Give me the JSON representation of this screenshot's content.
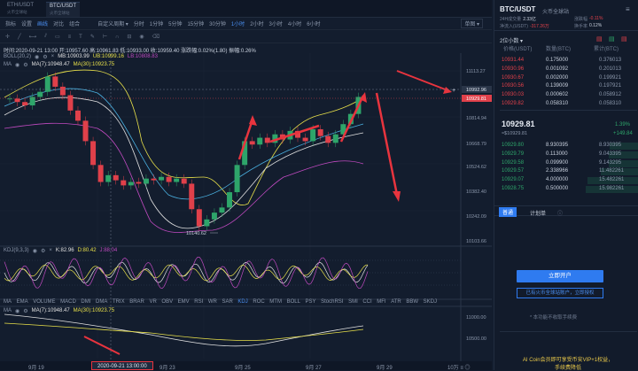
{
  "tabs": [
    {
      "label": "ETH/USDT",
      "sub": "火币全球站"
    },
    {
      "label": "BTC/USDT",
      "sub": "火币全球站"
    }
  ],
  "toolbar": {
    "items": [
      "指标",
      "设置",
      "画线",
      "对比",
      "组合",
      "自定义周期 ▾",
      "分时",
      "1分钟",
      "5分钟",
      "15分钟",
      "30分钟",
      "1小时",
      "2小时",
      "3小时",
      "4小时",
      "6小时"
    ],
    "active": [
      "画线",
      "1小时"
    ],
    "select": "单图 ▾"
  },
  "ohlc": "时间:2020-09-21 13:00 开:10957.60 高:10961.83 低:10933.00 收:10959.40 涨跌幅:0.02%(1.80) 振幅:0.26%",
  "boll": {
    "name": "BOLL(20,2)",
    "mb": "MB:10903.99",
    "ub": "UB:10999.16",
    "lb": "LB:10808.83"
  },
  "ma": {
    "name": "MA",
    "ma7": "MA(7):10948.47",
    "ma30": "MA(30):10923.75"
  },
  "kdj": {
    "name": "KDJ(9,3,3)",
    "k": "K:82.96",
    "d": "D:80.42",
    "j": "J:88.04"
  },
  "ma2": {
    "name": "MA",
    "ma7": "MA(7):10948.47",
    "ma30": "MA(30):10923.75"
  },
  "indicators": [
    "MA",
    "EMA",
    "VOLUME",
    "MACD",
    "DMI",
    "DMA",
    "TRIX",
    "BRAR",
    "VR",
    "OBV",
    "EMV",
    "RSI",
    "WR",
    "SAR",
    "KDJ",
    "ROC",
    "MTM",
    "BOLL",
    "PSY",
    "StochRSI",
    "SMI",
    "CCI",
    "MFI",
    "ATR",
    "BBW",
    "SKDJ"
  ],
  "activeIndicator": "KDJ",
  "yticks": [
    "11113.27",
    "10992.96",
    "10814.94",
    "10668.79",
    "10524.62",
    "10382.40",
    "10242.09",
    "10103.66"
  ],
  "yticks2": [
    "11000.00",
    "10500.00"
  ],
  "priceTag": "10929.81",
  "lowLabel": "10140.62",
  "xticks": [
    "9月 19",
    "9月 23",
    "9月 25",
    "9月 27",
    "9月 29"
  ],
  "xcursor": "2020-09-21 13:00:00",
  "zoom": "10万 ≡ ◎",
  "chart_data": {
    "type": "candlestick",
    "ylim": [
      10103.66,
      11113.27
    ],
    "close": [
      10950,
      10930,
      10910,
      10960,
      10990,
      11080,
      11020,
      10970,
      10880,
      10820,
      10700,
      10560,
      10460,
      10500,
      10470,
      10440,
      10460,
      10450,
      10480,
      10470,
      10490,
      10460,
      10480,
      10450,
      10300,
      10200,
      10240,
      10280,
      10310,
      10400,
      10560,
      10700,
      10680,
      10720,
      10690,
      10740,
      10710,
      10760,
      10720,
      10700,
      10770,
      10730,
      10690,
      10740,
      10800,
      10860,
      10960
    ],
    "kdj_levels": [
      80,
      50,
      20
    ]
  },
  "rp": {
    "pair": "BTC/USDT",
    "exchange": "火币全球站",
    "stat1": "24H成交量",
    "stat1v": "2.33亿",
    "stat2": "涨跌幅",
    "stat2v": "-0.11%",
    "stat3": "净流入(USDT)",
    "stat3v": "-317.26万",
    "stat4": "换手率",
    "stat4v": "0.12%",
    "depthSel": "2位小数 ▾",
    "headers": [
      "价格(USDT)",
      "数量(BTC)",
      "累计(BTC)"
    ],
    "asks": [
      [
        "10931.44",
        "0.175000",
        "0.376013"
      ],
      [
        "10930.96",
        "0.001092",
        "0.201013"
      ],
      [
        "10930.67",
        "0.002000",
        "0.199921"
      ],
      [
        "10930.56",
        "0.139009",
        "0.197921"
      ],
      [
        "10930.03",
        "0.000602",
        "0.058912"
      ],
      [
        "10929.82",
        "0.058310",
        "0.058310"
      ]
    ],
    "last": "10929.81",
    "lastCny": "≈$10929.81",
    "chg": "1.39%",
    "chgAbs": "+149.84",
    "bids": [
      [
        "10929.80",
        "8.930395",
        "8.930395"
      ],
      [
        "10929.79",
        "0.113000",
        "9.043395"
      ],
      [
        "10929.58",
        "0.099900",
        "9.143295"
      ],
      [
        "10929.57",
        "2.338966",
        "11.482261"
      ],
      [
        "10929.07",
        "4.000000",
        "15.482261"
      ],
      [
        "10928.75",
        "0.500000",
        "15.982261"
      ]
    ],
    "tab1": "普通",
    "tab2": "计划单",
    "openBtn": "立即开户",
    "bindBtn": "已有火币全球站账户，立即授权",
    "note": "* 本功能不收取手续费",
    "promo": "AI Coin会员即可享受币安VIP+1权益，",
    "promo2": "手续费降低"
  },
  "colors": {
    "up": "#2ea56a",
    "down": "#e0404a",
    "accent": "#2f7bf0",
    "arrow": "#e8343e"
  }
}
